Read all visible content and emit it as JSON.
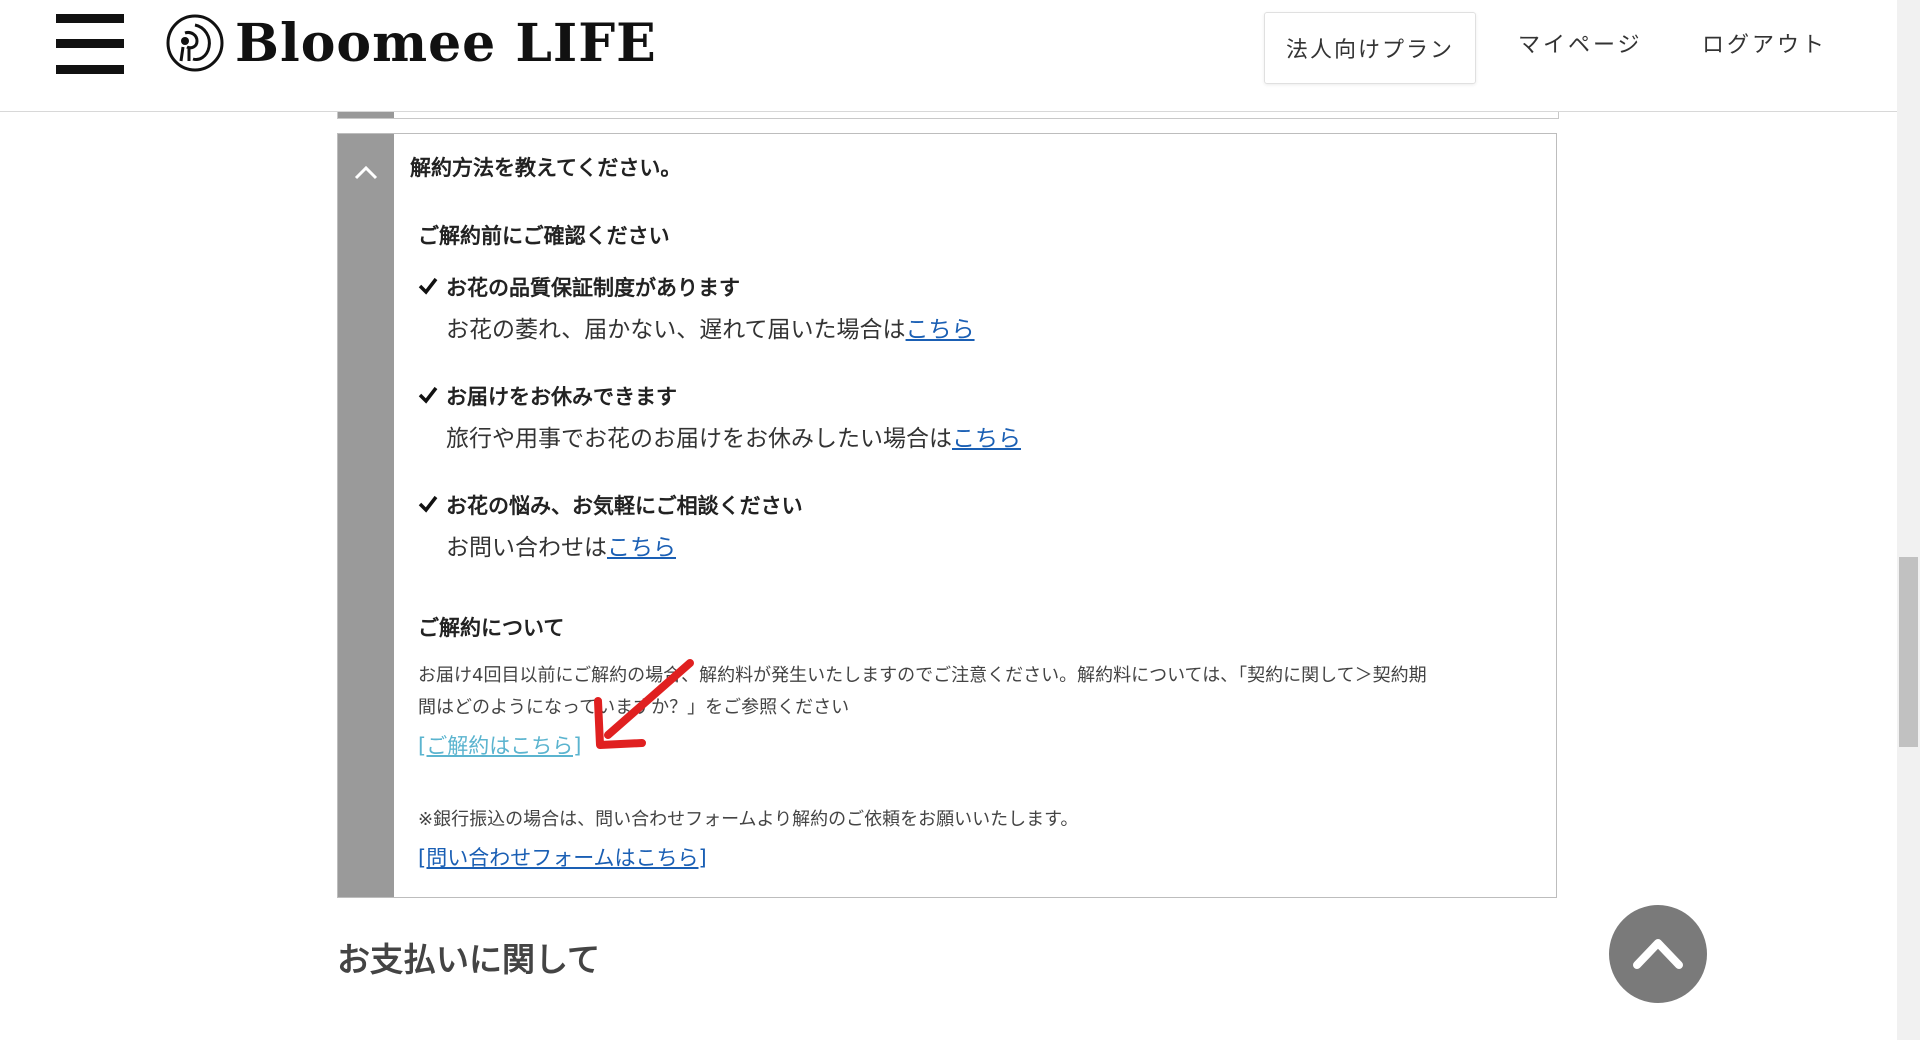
{
  "header": {
    "logo_text": "Bloomee LIFE",
    "nav": {
      "business_plan": "法人向けプラン",
      "mypage": "マイページ",
      "logout": "ログアウト"
    }
  },
  "faq": {
    "question": "解約方法を教えてください。",
    "confirm_title": "ご解約前にご確認ください",
    "checks": [
      {
        "title": "お花の品質保証制度があります",
        "desc": "お花の萎れ、届かない、遅れて届いた場合は",
        "link": "こちら"
      },
      {
        "title": "お届けをお休みできます",
        "desc": "旅行や用事でお花のお届けをお休みしたい場合は",
        "link": "こちら"
      },
      {
        "title": "お花の悩み、お気軽にご相談ください",
        "desc": "お問い合わせは",
        "link": "こちら"
      }
    ],
    "about_title": "ご解約について",
    "about_note_line1": "お届け4回目以前にご解約の場合、解約料が発生いたしますのでご注意ください。解約料については、「契約に関して＞契約期",
    "about_note_line2": "間はどのようになっていますか？」をご参照ください",
    "cancel_link": "[ご解約はこちら]",
    "bank_note": "※銀行振込の場合は、問い合わせフォームより解約のご依頼をお願いいたします。",
    "form_link": "[問い合わせフォームはこちら]"
  },
  "next_section": {
    "heading": "お支払いに関して"
  },
  "colors": {
    "accent_link": "#1a5fb4",
    "cancel_link": "#5bb4cf",
    "arrow": "#e02020",
    "side_bar": "#9a9a9a"
  },
  "icons": [
    "menu-icon",
    "logo-icon",
    "chevron-up-icon",
    "check-icon",
    "arrow-icon"
  ]
}
